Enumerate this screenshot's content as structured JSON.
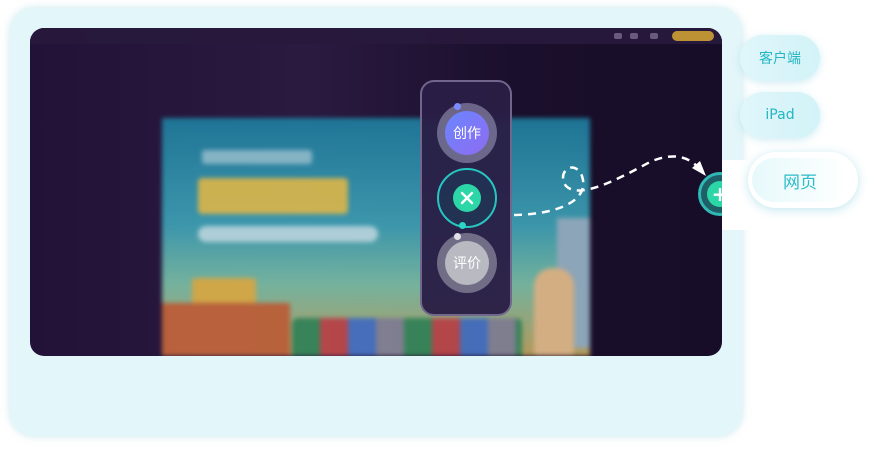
{
  "panel": {
    "create_label": "创作",
    "review_label": "评价"
  },
  "platforms": {
    "client_label": "客户端",
    "ipad_label": "iPad",
    "web_label": "网页"
  },
  "colors": {
    "accent_teal": "#2abdc9",
    "accent_green": "#2cd6a6",
    "panel_bg": "#2a1e46",
    "card_bg": "#e3f6fa"
  },
  "icons": {
    "close": "close-icon",
    "add": "plus-icon"
  }
}
